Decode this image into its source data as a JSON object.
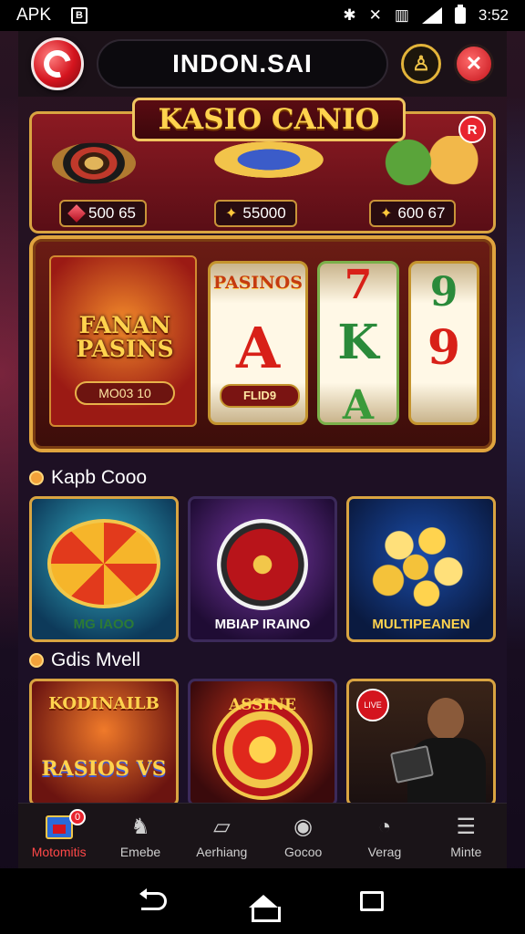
{
  "status_bar": {
    "carrier": "APK",
    "time": "3:52"
  },
  "header": {
    "title": "INDON.SAI"
  },
  "promo": {
    "title": "KASIO CANIO",
    "badge": "R",
    "pills": [
      {
        "value": "500 65"
      },
      {
        "value": "55000"
      },
      {
        "value": "600 67"
      }
    ]
  },
  "slot": {
    "feature_title": "FANAN PASINS",
    "feature_code": "MO03 10",
    "reel1_label": "PASINOS",
    "reel1_symbol": "A",
    "reel1_bottom": "FLID9",
    "reel2_top": "7",
    "reel2_symbol": "K",
    "reel2_bottom": "A",
    "reel3_top": "9",
    "reel3_symbol": "9"
  },
  "sections": [
    {
      "title": "Kapb Cooo"
    },
    {
      "title": "Gdis Mvell"
    }
  ],
  "games_row1": [
    {
      "label": "MG IAOO"
    },
    {
      "label": "MBIAP IRAINO"
    },
    {
      "label": "MULTIPEANEN"
    }
  ],
  "games_row2": [
    {
      "title": "KODINAILB",
      "sub": "RASIOS VS"
    },
    {
      "title": "ASSINE"
    },
    {
      "badge": "LIVE"
    }
  ],
  "bottom_nav": {
    "items": [
      {
        "label": "Motomitis",
        "badge": "0"
      },
      {
        "label": "Emebe"
      },
      {
        "label": "Aerhiang"
      },
      {
        "label": "Gocoo"
      },
      {
        "label": "Verag"
      },
      {
        "label": "Minte"
      }
    ]
  },
  "colors": {
    "accent_gold": "#d9a441",
    "accent_red": "#e8242e",
    "active_nav": "#ff4848"
  }
}
